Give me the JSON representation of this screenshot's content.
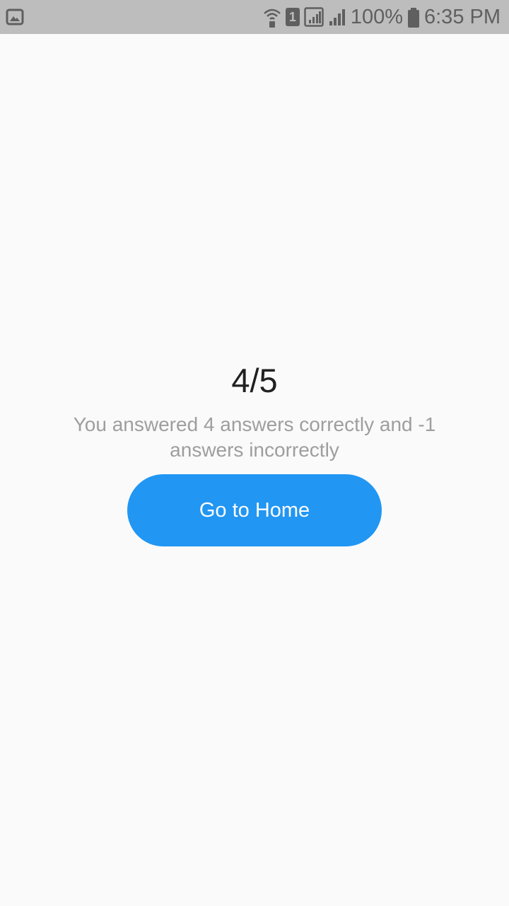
{
  "status_bar": {
    "battery_percent": "100%",
    "time": "6:35 PM",
    "sim_slot": "1",
    "icons": [
      "gallery-notification-icon",
      "wifi-calling-icon",
      "sim-1-icon",
      "signal-sim1-icon",
      "signal-sim2-icon",
      "battery-icon"
    ]
  },
  "result": {
    "score": "4/5",
    "message": "You answered 4 answers correctly and -1 answers incorrectly"
  },
  "actions": {
    "home_label": "Go to Home"
  },
  "colors": {
    "status_bar_bg": "#bdbdbd",
    "background": "#fafafa",
    "button": "#2196f3",
    "score_text": "#212121",
    "message_text": "#9e9e9e"
  }
}
